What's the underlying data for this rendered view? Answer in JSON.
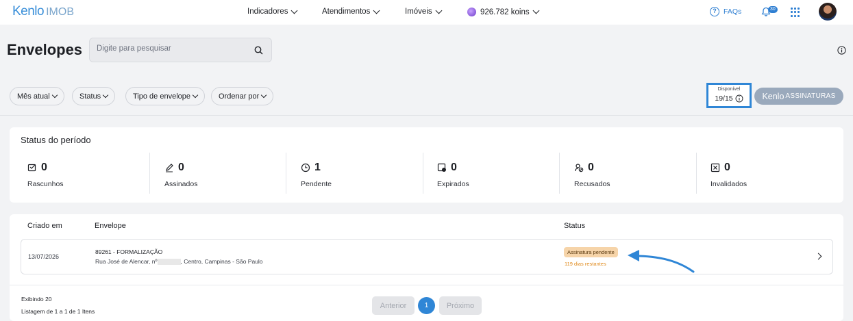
{
  "brand": {
    "logo": "Kenlo",
    "product": "IMOB"
  },
  "nav": {
    "items": [
      {
        "label": "Indicadores"
      },
      {
        "label": "Atendimentos"
      },
      {
        "label": "Imóveis"
      },
      {
        "label": "926.782 koins"
      }
    ],
    "faq_label": "FAQs",
    "notification_count": "30"
  },
  "page": {
    "title": "Envelopes",
    "search_placeholder": "Digite para pesquisar"
  },
  "filters": [
    "Mês atual",
    "Status",
    "Tipo de envelope",
    "Ordenar por"
  ],
  "available": {
    "label": "Disponível",
    "value": "19/15"
  },
  "sign_button": {
    "brand": "Kenlo",
    "label": "ASSINATURAS"
  },
  "period_status": {
    "title": "Status do período",
    "stats": [
      {
        "icon": "draft-icon",
        "count": "0",
        "label": "Rascunhos"
      },
      {
        "icon": "pen-icon",
        "count": "0",
        "label": "Assinados"
      },
      {
        "icon": "clock-icon",
        "count": "1",
        "label": "Pendente"
      },
      {
        "icon": "expired-icon",
        "count": "0",
        "label": "Expirados"
      },
      {
        "icon": "refused-icon",
        "count": "0",
        "label": "Recusados"
      },
      {
        "icon": "invalid-icon",
        "count": "0",
        "label": "Invalidados"
      }
    ]
  },
  "table": {
    "headers": {
      "created": "Criado em",
      "envelope": "Envelope",
      "status": "Status"
    },
    "rows": [
      {
        "created": "13/07/2026",
        "title": "89261 - FORMALIZAÇÃO",
        "address_start": "Rua José de Alencar, nº",
        "address_end": ", Centro, Campinas - São Paulo",
        "status": "Assinatura pendente",
        "remaining": "119 dias restantes"
      }
    ]
  },
  "footer": {
    "showing": "Exibindo 20",
    "listing": "Listagem de 1 a 1 de 1 Itens",
    "prev": "Anterior",
    "page": "1",
    "next": "Próximo"
  },
  "colors": {
    "accent": "#2f86d6",
    "pending_badge": "#f6d4a9",
    "pending_text": "#e08a1b"
  }
}
